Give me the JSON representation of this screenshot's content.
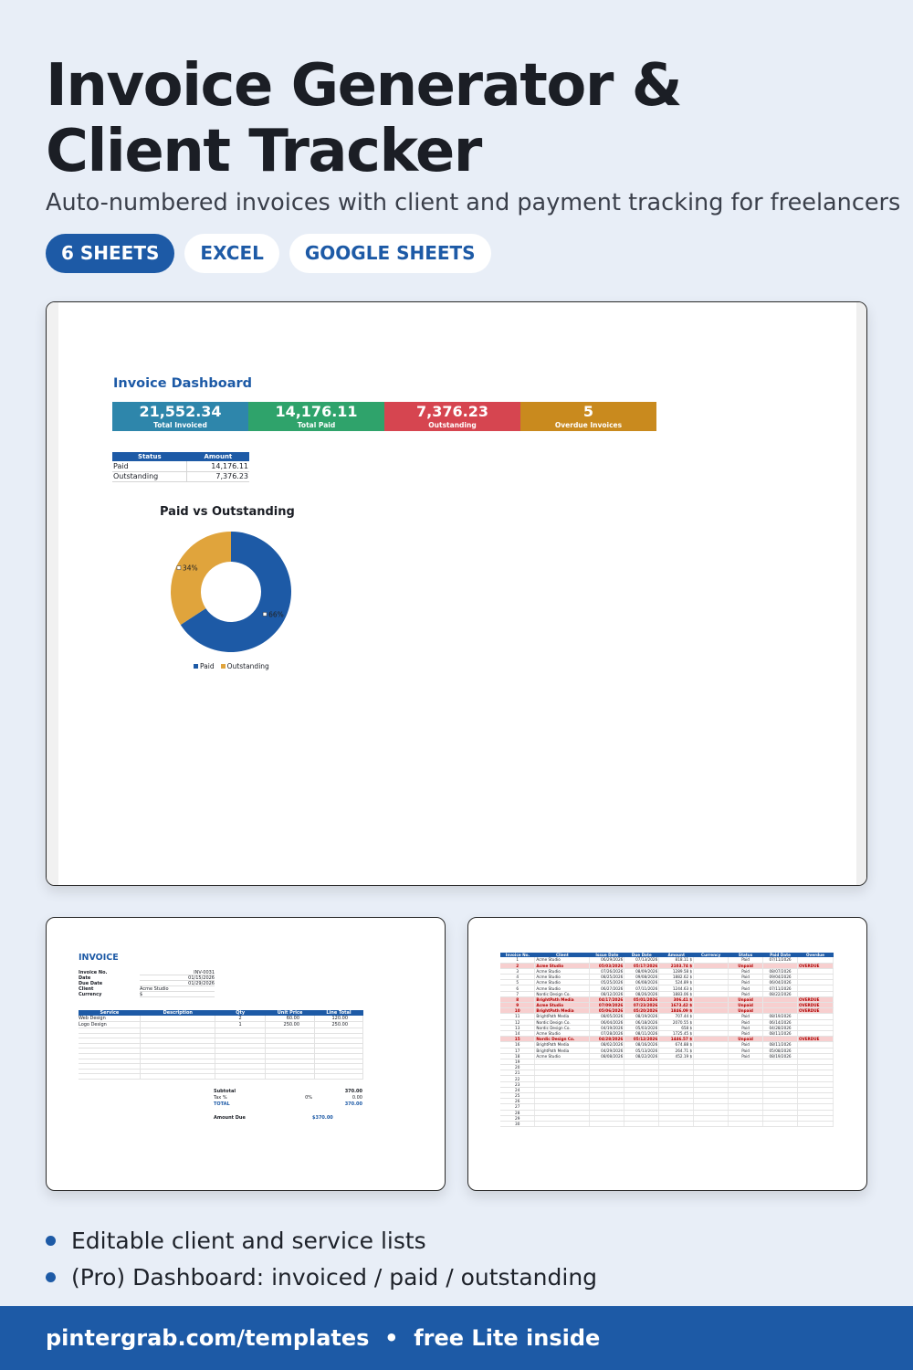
{
  "header": {
    "title": "Invoice Generator & Client Tracker",
    "subtitle": "Auto-numbered invoices with client and payment tracking for freelancers"
  },
  "tags": [
    "6 SHEETS",
    "EXCEL",
    "GOOGLE SHEETS"
  ],
  "dashboard": {
    "title": "Invoice Dashboard",
    "kpis": [
      {
        "value": "21,552.34",
        "label": "Total Invoiced",
        "color": "#2e86ab"
      },
      {
        "value": "14,176.11",
        "label": "Total Paid",
        "color": "#2fa36b"
      },
      {
        "value": "7,376.23",
        "label": "Outstanding",
        "color": "#d64550"
      },
      {
        "value": "5",
        "label": "Overdue Invoices",
        "color": "#c98a1e"
      }
    ],
    "status_table": {
      "headers": [
        "Status",
        "Amount"
      ],
      "rows": [
        [
          "Paid",
          "14,176.11"
        ],
        [
          "Outstanding",
          "7,376.23"
        ]
      ]
    }
  },
  "chart_data": {
    "type": "pie",
    "title": "Paid vs Outstanding",
    "categories": [
      "Paid",
      "Outstanding"
    ],
    "values": [
      14176.11,
      7376.23
    ],
    "data_labels": [
      "66%",
      "34%"
    ],
    "colors": [
      "#1d5aa6",
      "#e0a43c"
    ],
    "legend": "bottom"
  },
  "invoice": {
    "title": "INVOICE",
    "fields": [
      {
        "label": "Invoice No.",
        "value": "INV-0031"
      },
      {
        "label": "Date",
        "value": "01/15/2026"
      },
      {
        "label": "Due Date",
        "value": "01/29/2026"
      },
      {
        "label": "Client",
        "value": "Acme Studio"
      },
      {
        "label": "Currency",
        "value": "$"
      }
    ],
    "headers": [
      "Service",
      "Description",
      "Qty",
      "Unit Price",
      "Line Total"
    ],
    "rows": [
      [
        "Web Design",
        "",
        "2",
        "60.00",
        "120.00"
      ],
      [
        "Logo Design",
        "",
        "1",
        "250.00",
        "250.00"
      ]
    ],
    "totals": {
      "subtotal_label": "Subtotal",
      "subtotal": "370.00",
      "tax_label": "Tax %",
      "tax_pct": "0%",
      "tax": "0.00",
      "total_label": "TOTAL",
      "total": "370.00",
      "due_label": "Amount Due",
      "due": "$370.00"
    }
  },
  "invoice_list": {
    "headers": [
      "Invoice No.",
      "Client",
      "Issue Date",
      "Due Date",
      "Amount",
      "Currency",
      "Status",
      "Paid Date",
      "Overdue"
    ],
    "rows": [
      [
        "1",
        "Acme Studio",
        "06/29/2026",
        "07/13/2026",
        "818.11",
        "$",
        "Paid",
        "07/11/2026",
        ""
      ],
      [
        "2",
        "Acme Studio",
        "05/03/2026",
        "05/17/2026",
        "2103.74",
        "$",
        "Unpaid",
        "",
        "OVERDUE"
      ],
      [
        "3",
        "Acme Studio",
        "07/26/2026",
        "08/09/2026",
        "1289.58",
        "$",
        "Paid",
        "08/07/2026",
        ""
      ],
      [
        "4",
        "Acme Studio",
        "08/25/2026",
        "09/08/2026",
        "1882.62",
        "$",
        "Paid",
        "09/04/2026",
        ""
      ],
      [
        "5",
        "Acme Studio",
        "05/25/2026",
        "06/08/2026",
        "524.89",
        "$",
        "Paid",
        "06/04/2026",
        ""
      ],
      [
        "6",
        "Acme Studio",
        "06/27/2026",
        "07/11/2026",
        "1244.63",
        "$",
        "Paid",
        "07/11/2026",
        ""
      ],
      [
        "7",
        "Nordic Design Co.",
        "08/12/2026",
        "08/26/2026",
        "1883.06",
        "$",
        "Paid",
        "08/22/2026",
        ""
      ],
      [
        "8",
        "BrightPath Media",
        "04/17/2026",
        "05/01/2026",
        "306.41",
        "$",
        "Unpaid",
        "",
        "OVERDUE"
      ],
      [
        "9",
        "Acme Studio",
        "07/09/2026",
        "07/23/2026",
        "1673.42",
        "$",
        "Unpaid",
        "",
        "OVERDUE"
      ],
      [
        "10",
        "BrightPath Media",
        "05/06/2026",
        "05/20/2026",
        "1846.09",
        "$",
        "Unpaid",
        "",
        "OVERDUE"
      ],
      [
        "11",
        "BrightPath Media",
        "08/05/2026",
        "08/19/2026",
        "707.44",
        "$",
        "Paid",
        "08/19/2026",
        ""
      ],
      [
        "12",
        "Nordic Design Co.",
        "06/04/2026",
        "06/18/2026",
        "2070.55",
        "$",
        "Paid",
        "06/14/2026",
        ""
      ],
      [
        "13",
        "Nordic Design Co.",
        "04/19/2026",
        "05/03/2026",
        "658",
        "$",
        "Paid",
        "04/28/2026",
        ""
      ],
      [
        "14",
        "Acme Studio",
        "07/28/2026",
        "08/11/2026",
        "1725.45",
        "$",
        "Paid",
        "08/11/2026",
        ""
      ],
      [
        "15",
        "Nordic Design Co.",
        "04/28/2026",
        "05/12/2026",
        "1446.57",
        "$",
        "Unpaid",
        "",
        "OVERDUE"
      ],
      [
        "16",
        "BrightPath Media",
        "08/02/2026",
        "08/16/2026",
        "674.88",
        "$",
        "Paid",
        "08/11/2026",
        ""
      ],
      [
        "17",
        "BrightPath Media",
        "04/29/2026",
        "05/13/2026",
        "264.71",
        "$",
        "Paid",
        "05/08/2026",
        ""
      ],
      [
        "18",
        "Acme Studio",
        "08/08/2026",
        "08/22/2026",
        "452.19",
        "$",
        "Paid",
        "08/19/2026",
        ""
      ]
    ],
    "empty_row_numbers": [
      "19",
      "20",
      "21",
      "22",
      "23",
      "24",
      "25",
      "26",
      "27",
      "28",
      "29",
      "30"
    ]
  },
  "features": [
    "Editable client and service lists",
    "(Pro) Dashboard: invoiced / paid / outstanding"
  ],
  "footer": {
    "text": "pintergrab.com/templates  •  free Lite inside"
  }
}
